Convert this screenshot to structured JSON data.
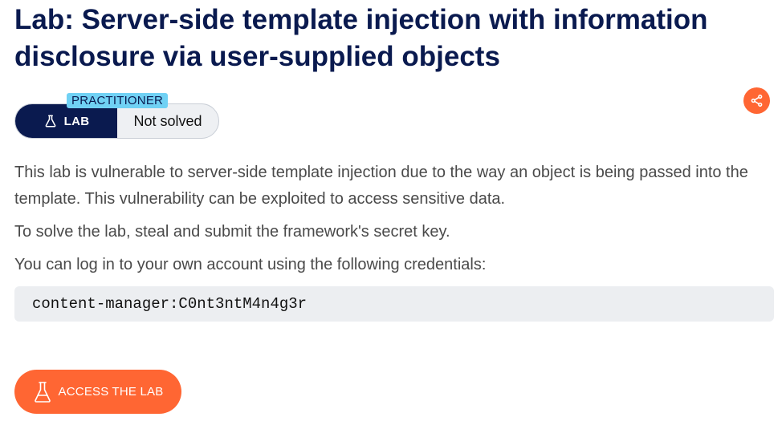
{
  "header": {
    "title": "Lab: Server-side template injection with information disclosure via user-supplied objects"
  },
  "badge": {
    "level": "PRACTITIONER",
    "lab_label": "LAB",
    "status": "Not solved"
  },
  "content": {
    "paragraph_1": "This lab is vulnerable to server-side template injection due to the way an object is being passed into the template. This vulnerability can be exploited to access sensitive data.",
    "paragraph_2": "To solve the lab, steal and submit the framework's secret key.",
    "paragraph_3": "You can log in to your own account using the following credentials:",
    "credentials": "content-manager:C0nt3ntM4n4g3r"
  },
  "actions": {
    "access_label": "ACCESS THE LAB"
  },
  "icons": {
    "share": "share-icon",
    "flask": "flask-icon"
  },
  "colors": {
    "title": "#0a1a4f",
    "accent_orange": "#ff6633",
    "lab_navy": "#0a1a4f",
    "level_tag": "#70d1f4",
    "code_bg": "#eceef1"
  }
}
